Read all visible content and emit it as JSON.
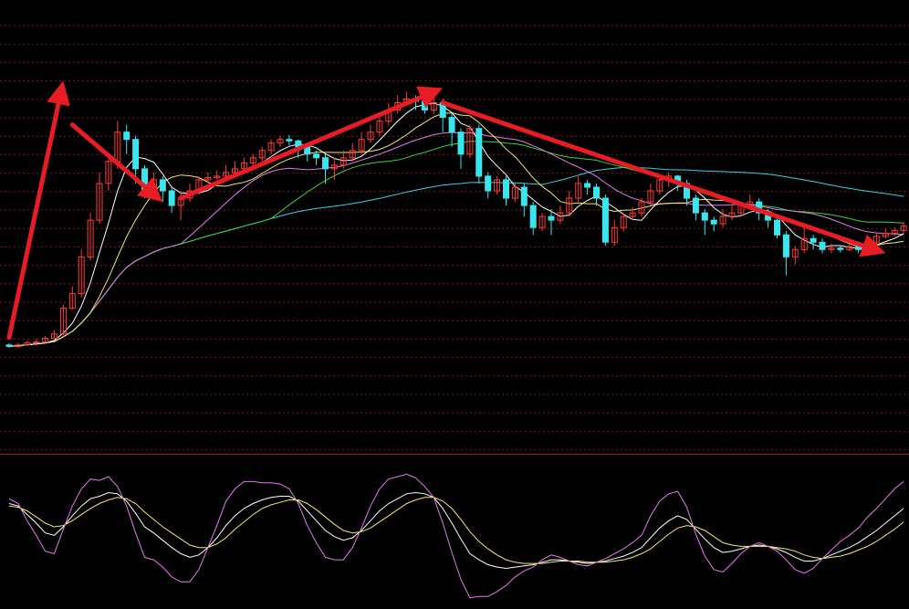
{
  "colors": {
    "background": "#000000",
    "grid": "#7a1a1a",
    "separator": "#a01a2a",
    "up": "#ff3b3b",
    "down": "#39e6f0",
    "ma5": "#ffffff",
    "ma10": "#f5e96a",
    "ma20": "#e07ce8",
    "ma30": "#3fcf3f",
    "ma60": "#3ad1e6",
    "kdj_k": "#ffffff",
    "kdj_d": "#f5e96a",
    "kdj_j": "#e07ce8",
    "arrow": "#e81c24"
  },
  "chart_data": [
    {
      "type": "candlestick",
      "panel": "price",
      "title": "",
      "grid": true,
      "ylim": [
        0,
        50
      ],
      "candles": [
        [
          1,
          4.0,
          3.8,
          4.2,
          3.6
        ],
        [
          2,
          3.8,
          4.0,
          4.3,
          3.6
        ],
        [
          3,
          4.0,
          4.3,
          4.6,
          3.9
        ],
        [
          4,
          4.3,
          4.4,
          4.8,
          4.1
        ],
        [
          5,
          4.4,
          4.9,
          5.2,
          4.3
        ],
        [
          6,
          4.9,
          5.5,
          6.0,
          4.8
        ],
        [
          7,
          5.5,
          9.0,
          9.5,
          5.3
        ],
        [
          8,
          9.0,
          11.0,
          12.0,
          8.8
        ],
        [
          9,
          11.0,
          16.0,
          17.0,
          10.5
        ],
        [
          10,
          16.0,
          21.0,
          22.0,
          15.5
        ],
        [
          11,
          21.0,
          26.0,
          27.5,
          20.5
        ],
        [
          12,
          26.0,
          29.0,
          30.0,
          25.0
        ],
        [
          13,
          29.0,
          33.0,
          34.5,
          28.0
        ],
        [
          14,
          33.0,
          32.0,
          34.0,
          30.0
        ],
        [
          15,
          32.0,
          28.0,
          32.5,
          26.0
        ],
        [
          16,
          28.0,
          25.0,
          28.5,
          24.0
        ],
        [
          17,
          25.0,
          26.5,
          27.5,
          24.0
        ],
        [
          18,
          26.5,
          25.0,
          27.0,
          23.5
        ],
        [
          19,
          25.0,
          23.0,
          25.5,
          22.0
        ],
        [
          20,
          23.0,
          24.0,
          25.0,
          21.0
        ],
        [
          21,
          24.0,
          25.0,
          26.0,
          23.5
        ],
        [
          22,
          25.0,
          26.5,
          27.0,
          24.5
        ],
        [
          23,
          26.5,
          26.8,
          27.5,
          26.0
        ],
        [
          24,
          26.8,
          27.0,
          27.8,
          26.5
        ],
        [
          25,
          27.0,
          27.5,
          28.5,
          26.5
        ],
        [
          26,
          27.5,
          28.0,
          29.0,
          27.0
        ],
        [
          27,
          28.0,
          28.8,
          29.5,
          27.5
        ],
        [
          28,
          28.8,
          29.5,
          30.0,
          28.0
        ],
        [
          29,
          29.5,
          30.5,
          31.0,
          29.0
        ],
        [
          30,
          30.5,
          31.5,
          32.0,
          30.0
        ],
        [
          31,
          31.5,
          32.0,
          32.5,
          31.0
        ],
        [
          32,
          32.0,
          31.8,
          32.6,
          31.2
        ],
        [
          33,
          31.8,
          31.0,
          32.0,
          29.5
        ],
        [
          34,
          31.0,
          30.0,
          31.2,
          29.0
        ],
        [
          35,
          30.0,
          29.5,
          30.5,
          28.5
        ],
        [
          36,
          29.5,
          28.0,
          30.0,
          26.0
        ],
        [
          37,
          28.0,
          28.5,
          29.5,
          26.5
        ],
        [
          38,
          28.5,
          29.5,
          30.5,
          28.0
        ],
        [
          39,
          29.5,
          30.5,
          31.5,
          29.0
        ],
        [
          40,
          30.5,
          32.0,
          33.0,
          30.0
        ],
        [
          41,
          32.0,
          33.0,
          34.0,
          31.5
        ],
        [
          42,
          33.0,
          34.5,
          35.0,
          32.5
        ],
        [
          43,
          34.5,
          36.0,
          37.0,
          34.0
        ],
        [
          44,
          36.0,
          37.0,
          38.0,
          35.5
        ],
        [
          45,
          37.0,
          37.5,
          38.5,
          36.5
        ],
        [
          46,
          37.5,
          37.2,
          38.0,
          36.0
        ],
        [
          47,
          37.2,
          36.0,
          37.5,
          35.5
        ],
        [
          48,
          36.0,
          37.0,
          38.0,
          35.5
        ],
        [
          49,
          37.0,
          35.0,
          37.5,
          33.0
        ],
        [
          50,
          35.0,
          33.0,
          35.5,
          31.0
        ],
        [
          51,
          33.0,
          30.0,
          33.5,
          28.0
        ],
        [
          52,
          30.0,
          33.5,
          34.0,
          29.5
        ],
        [
          53,
          33.5,
          27.0,
          34.0,
          26.0
        ],
        [
          54,
          27.0,
          25.0,
          27.5,
          24.0
        ],
        [
          55,
          25.0,
          26.5,
          27.0,
          24.5
        ],
        [
          56,
          26.5,
          24.0,
          27.0,
          23.0
        ],
        [
          57,
          24.0,
          25.5,
          26.0,
          23.5
        ],
        [
          58,
          25.5,
          23.0,
          26.0,
          21.5
        ],
        [
          59,
          23.0,
          20.0,
          23.5,
          19.0
        ],
        [
          60,
          20.0,
          21.5,
          22.0,
          19.5
        ],
        [
          61,
          21.5,
          21.0,
          22.5,
          19.0
        ],
        [
          62,
          21.0,
          22.0,
          23.0,
          20.5
        ],
        [
          63,
          22.0,
          24.0,
          25.0,
          21.5
        ],
        [
          64,
          24.0,
          26.0,
          27.0,
          23.5
        ],
        [
          65,
          26.0,
          25.5,
          26.5,
          24.5
        ],
        [
          66,
          25.5,
          24.0,
          26.0,
          23.0
        ],
        [
          67,
          24.0,
          18.0,
          24.5,
          17.5
        ],
        [
          68,
          18.0,
          20.0,
          21.0,
          17.5
        ],
        [
          69,
          20.0,
          21.5,
          22.0,
          19.5
        ],
        [
          70,
          21.5,
          22.0,
          22.8,
          21.0
        ],
        [
          71,
          22.0,
          23.5,
          24.0,
          21.5
        ],
        [
          72,
          23.5,
          25.0,
          26.0,
          23.0
        ],
        [
          73,
          25.0,
          26.5,
          27.0,
          24.5
        ],
        [
          74,
          26.5,
          27.0,
          27.5,
          25.5
        ],
        [
          75,
          27.0,
          26.0,
          27.2,
          25.0
        ],
        [
          76,
          26.0,
          24.0,
          26.5,
          23.0
        ],
        [
          77,
          24.0,
          22.0,
          24.5,
          21.0
        ],
        [
          78,
          22.0,
          21.0,
          22.5,
          19.0
        ],
        [
          79,
          21.0,
          20.5,
          21.5,
          19.5
        ],
        [
          80,
          20.5,
          21.5,
          22.5,
          20.0
        ],
        [
          81,
          21.5,
          22.0,
          23.0,
          21.0
        ],
        [
          82,
          22.0,
          23.0,
          23.5,
          21.5
        ],
        [
          83,
          23.0,
          23.5,
          24.5,
          22.5
        ],
        [
          84,
          23.5,
          22.0,
          24.0,
          21.0
        ],
        [
          85,
          22.0,
          21.0,
          22.5,
          20.0
        ],
        [
          86,
          21.0,
          19.0,
          21.5,
          18.5
        ],
        [
          87,
          19.0,
          16.0,
          19.5,
          13.5
        ],
        [
          88,
          16.0,
          17.0,
          17.5,
          15.0
        ],
        [
          89,
          17.0,
          18.5,
          20.0,
          16.5
        ],
        [
          90,
          18.5,
          18.0,
          19.0,
          17.0
        ],
        [
          91,
          18.0,
          17.0,
          18.5,
          16.5
        ],
        [
          92,
          17.0,
          17.2,
          17.8,
          16.5
        ],
        [
          93,
          17.2,
          17.0,
          17.6,
          16.6
        ],
        [
          94,
          17.0,
          17.4,
          17.8,
          16.8
        ],
        [
          95,
          17.4,
          17.0,
          18.0,
          16.5
        ],
        [
          96,
          17.0,
          18.0,
          18.5,
          16.8
        ],
        [
          97,
          18.0,
          18.8,
          19.2,
          17.5
        ],
        [
          98,
          18.8,
          19.2,
          19.8,
          18.5
        ],
        [
          99,
          19.2,
          19.6,
          20.0,
          18.8
        ],
        [
          100,
          19.6,
          20.2,
          20.8,
          19.2
        ]
      ]
    },
    {
      "type": "line",
      "panel": "oscillator",
      "title": "",
      "grid": false,
      "ylim": [
        0,
        100
      ],
      "series": [
        {
          "key": "kdj_k",
          "values": [
            74,
            72,
            65,
            58,
            50,
            48,
            55,
            64,
            72,
            78,
            80,
            83,
            82,
            76,
            66,
            55,
            50,
            44,
            38,
            33,
            30,
            32,
            38,
            46,
            56,
            64,
            70,
            74,
            77,
            79,
            80,
            80,
            76,
            68,
            60,
            52,
            47,
            44,
            46,
            52,
            60,
            68,
            74,
            78,
            82,
            83,
            82,
            79,
            70,
            58,
            45,
            33,
            28,
            24,
            22,
            21,
            22,
            23,
            24,
            26,
            28,
            28,
            27,
            26,
            25,
            26,
            27,
            29,
            31,
            34,
            38,
            46,
            54,
            60,
            64,
            61,
            53,
            45,
            38,
            34,
            35,
            37,
            39,
            40,
            39,
            37,
            34,
            30,
            27,
            27,
            29,
            32,
            35,
            38,
            42,
            47,
            52,
            58,
            64,
            70
          ]
        },
        {
          "key": "kdj_d",
          "values": [
            72,
            71,
            68,
            63,
            58,
            55,
            56,
            60,
            65,
            70,
            74,
            77,
            79,
            78,
            74,
            67,
            61,
            55,
            50,
            45,
            40,
            38,
            38,
            41,
            46,
            53,
            59,
            65,
            70,
            73,
            75,
            77,
            77,
            74,
            69,
            63,
            57,
            52,
            50,
            51,
            54,
            59,
            64,
            69,
            74,
            77,
            79,
            79,
            76,
            70,
            61,
            51,
            43,
            37,
            32,
            28,
            26,
            25,
            25,
            25,
            26,
            27,
            27,
            27,
            26,
            26,
            26,
            27,
            28,
            30,
            33,
            37,
            43,
            49,
            54,
            56,
            55,
            52,
            47,
            42,
            40,
            39,
            39,
            39,
            39,
            38,
            37,
            35,
            32,
            30,
            29,
            30,
            31,
            33,
            36,
            39,
            43,
            48,
            53,
            59
          ]
        },
        {
          "key": "kdj_j",
          "values": [
            78,
            74,
            60,
            48,
            35,
            33,
            53,
            72,
            86,
            94,
            93,
            96,
            88,
            72,
            50,
            30,
            28,
            22,
            14,
            10,
            10,
            20,
            38,
            56,
            76,
            86,
            92,
            92,
            91,
            91,
            90,
            86,
            74,
            56,
            42,
            30,
            28,
            28,
            38,
            54,
            72,
            86,
            94,
            96,
            98,
            95,
            88,
            79,
            58,
            34,
            12,
            -3,
            -2,
            -2,
            2,
            7,
            14,
            19,
            22,
            28,
            32,
            30,
            27,
            24,
            23,
            26,
            29,
            33,
            37,
            42,
            48,
            64,
            76,
            82,
            84,
            71,
            49,
            31,
            20,
            18,
            25,
            33,
            39,
            42,
            39,
            35,
            28,
            20,
            17,
            21,
            29,
            36,
            43,
            48,
            54,
            63,
            70,
            78,
            86,
            92
          ]
        }
      ]
    }
  ],
  "annotations": {
    "arrows": [
      {
        "from": [
          1,
          5
        ],
        "to": [
          7,
          40
        ]
      },
      {
        "from": [
          8,
          34
        ],
        "to": [
          18,
          23.5
        ]
      },
      {
        "from": [
          20,
          24
        ],
        "to": [
          49,
          39
        ]
      },
      {
        "from": [
          49,
          37
        ],
        "to": [
          98,
          16.5
        ]
      }
    ]
  }
}
